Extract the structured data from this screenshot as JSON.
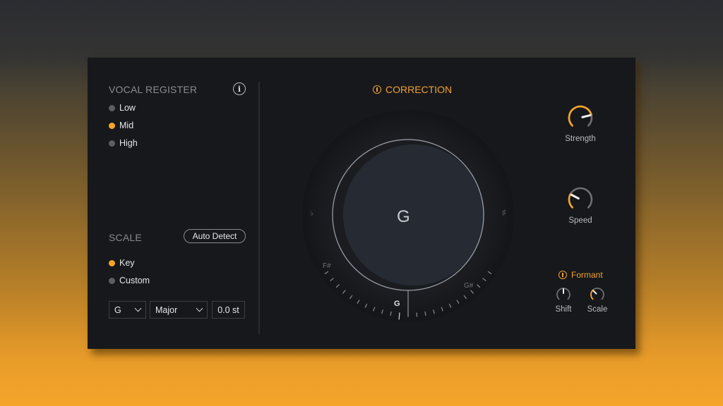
{
  "vocal_register": {
    "title": "VOCAL REGISTER",
    "info_icon": "info-icon",
    "options": [
      {
        "label": "Low",
        "selected": false
      },
      {
        "label": "Mid",
        "selected": true
      },
      {
        "label": "High",
        "selected": false
      }
    ]
  },
  "scale": {
    "title": "SCALE",
    "auto_detect_label": "Auto Detect",
    "options": [
      {
        "label": "Key",
        "selected": true
      },
      {
        "label": "Custom",
        "selected": false
      }
    ],
    "key_select": "G",
    "mode_select": "Major",
    "transpose_value": "0.0 st"
  },
  "correction": {
    "title": "CORRECTION",
    "power_icon": "power-icon",
    "current_note": "G",
    "flat_label": "♭",
    "sharp_label": "♯",
    "note_left": "F#",
    "note_center": "G",
    "note_right": "G#"
  },
  "knobs": {
    "strength": {
      "label": "Strength",
      "value": 0.78
    },
    "speed": {
      "label": "Speed",
      "value": 0.27
    }
  },
  "formant": {
    "title": "Formant",
    "power_icon": "power-icon",
    "shift": {
      "label": "Shift",
      "value": 0.5
    },
    "scale": {
      "label": "Scale",
      "value": 0.33
    }
  },
  "colors": {
    "accent": "#f5a52a",
    "panel": "#17181b",
    "dial_disk": "#262b33",
    "knob_track": "#6e6f74"
  }
}
